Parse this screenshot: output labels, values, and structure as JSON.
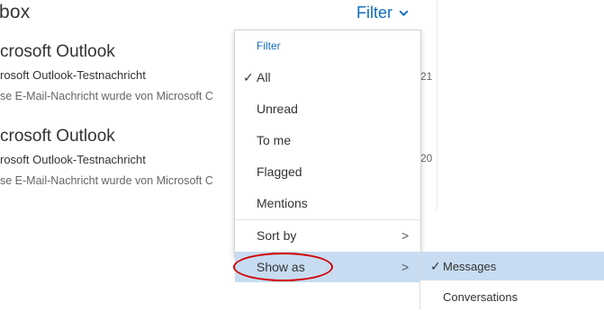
{
  "inbox": {
    "title": "box",
    "filter_label": "Filter",
    "messages": [
      {
        "sender": "crosoft Outlook",
        "subject": "rosoft Outlook-Testnachricht",
        "preview": "se E-Mail-Nachricht wurde von Microsoft C",
        "time": "21"
      },
      {
        "sender": "crosoft Outlook",
        "subject": "rosoft Outlook-Testnachricht",
        "preview": "se E-Mail-Nachricht wurde von Microsoft C",
        "time": "20"
      }
    ]
  },
  "filter_menu": {
    "header": "Filter",
    "items": [
      {
        "label": "All",
        "checked": true
      },
      {
        "label": "Unread"
      },
      {
        "label": "To me"
      },
      {
        "label": "Flagged"
      },
      {
        "label": "Mentions"
      }
    ],
    "sort_by": "Sort by",
    "show_as": "Show as"
  },
  "submenu": {
    "items": [
      {
        "label": "Messages",
        "checked": true
      },
      {
        "label": "Conversations"
      }
    ]
  },
  "check_glyph": "✓",
  "arrow_glyph": ">",
  "colors": {
    "accent": "#0f6cbd",
    "highlight": "#c7dcf1",
    "annotation": "#d40000"
  }
}
